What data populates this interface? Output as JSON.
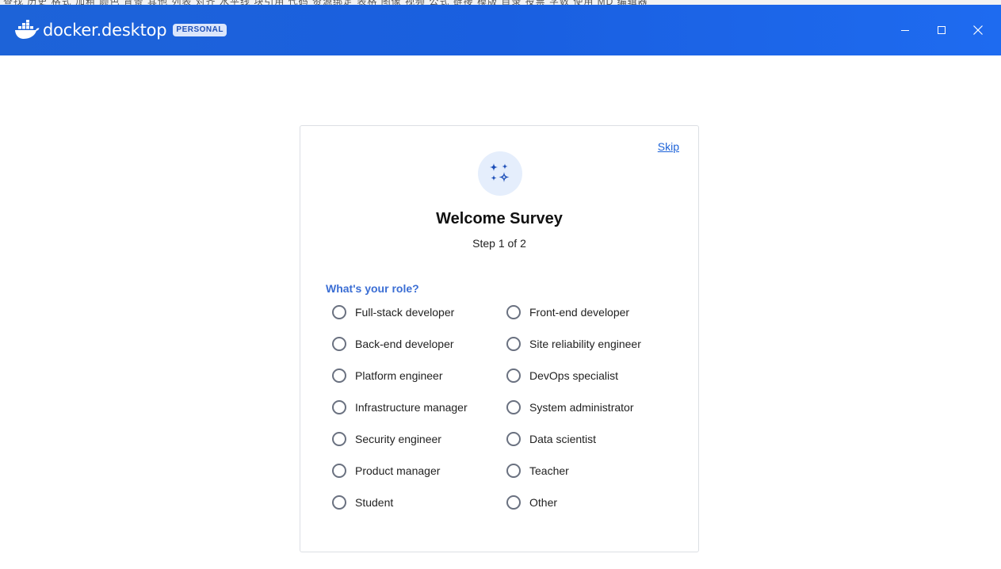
{
  "app": {
    "wordmark": "docker.desktop",
    "edition_badge": "PERSONAL",
    "logo_icon": "docker-whale-icon",
    "titlebar_color": "#1d63d8"
  },
  "background_window": {
    "menu_items": [
      "查找",
      "历史",
      "格式",
      "加粗",
      "颜色",
      "背景",
      "其他",
      "列表",
      "对齐",
      "水平线",
      "块引用",
      "代码",
      "资源绑定",
      "表格",
      "图像",
      "视频",
      "公式",
      "链接",
      "模版",
      "目录",
      "投票",
      "字数",
      "使用 MD 编辑器"
    ]
  },
  "window_controls": {
    "minimize_icon": "minimize-icon",
    "maximize_icon": "maximize-icon",
    "close_icon": "close-icon"
  },
  "survey": {
    "skip_label": "Skip",
    "hero_icon": "sparkles-icon",
    "title": "Welcome Survey",
    "step": "Step 1 of 2",
    "question": "What's your role?",
    "accent_color": "#3b6ed4",
    "options": [
      "Full-stack developer",
      "Front-end developer",
      "Back-end developer",
      "Site reliability engineer",
      "Platform engineer",
      "DevOps specialist",
      "Infrastructure manager",
      "System administrator",
      "Security engineer",
      "Data scientist",
      "Product manager",
      "Teacher",
      "Student",
      "Other"
    ],
    "selected": null
  }
}
